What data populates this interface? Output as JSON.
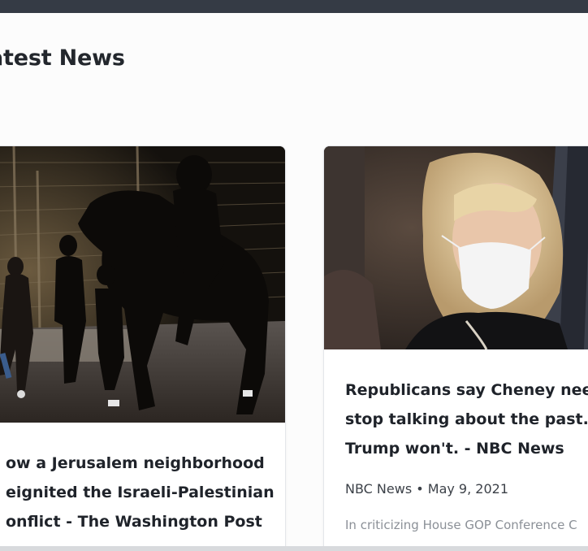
{
  "section": {
    "title": "atest News"
  },
  "articles": [
    {
      "title_lines": [
        "ow a Jerusalem neighborhood",
        "eignited the Israeli-Palestinian",
        "onflict - The Washington Post"
      ],
      "image_alt": "mounted police horse at night"
    },
    {
      "title_lines": [
        "Republicans say Cheney need",
        "stop talking about the past. E",
        "Trump won't. - NBC News"
      ],
      "meta": "NBC News • May 9, 2021",
      "excerpt_lines": [
        "In criticizing House GOP Conference C",
        ""
      ],
      "image_alt": "woman wearing white mask"
    }
  ],
  "colors": {
    "topbar": "#353b45",
    "title": "#23272d",
    "excerpt": "#8b9097"
  }
}
